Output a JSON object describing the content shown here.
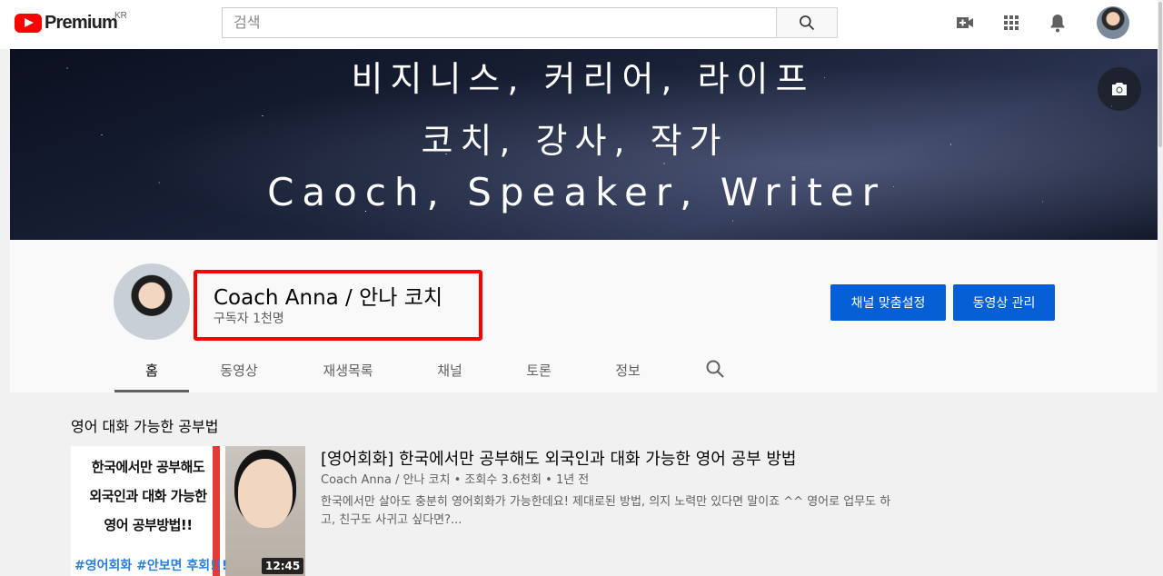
{
  "topbar": {
    "logo_text": "Premium",
    "country_code": "KR",
    "search_placeholder": "검색"
  },
  "banner": {
    "line1": "비지니스, 커리어, 라이프",
    "line2": "코치, 강사, 작가",
    "line3": "Caoch, Speaker, Writer"
  },
  "channel": {
    "name": "Coach Anna / 안나 코치",
    "subscribers": "구독자 1천명",
    "customize_label": "채널 맞춤설정",
    "manage_label": "동영상 관리",
    "accent_color": "#065fd4",
    "highlight_color": "#ff0000"
  },
  "tabs": [
    {
      "label": "홈",
      "active": true
    },
    {
      "label": "동영상"
    },
    {
      "label": "재생목록"
    },
    {
      "label": "채널"
    },
    {
      "label": "토론"
    },
    {
      "label": "정보"
    }
  ],
  "section": {
    "title": "영어 대화 가능한 공부법"
  },
  "video": {
    "thumb_line1": "한국에서만 공부해도",
    "thumb_line2": "외국인과 대화 가능한",
    "thumb_line3": "영어 공부방법!!",
    "thumb_tags": "#영어회화 #안보면 후회!!!",
    "duration": "12:45",
    "title": "[영어회화] 한국에서만 공부해도 외국인과 대화 가능한 영어 공부 방법",
    "meta": "Coach Anna / 안나 코치 • 조회수 3.6천회 • 1년 전",
    "description": "한국에서만 살아도 충분히 영어회화가 가능한데요! 제대로된 방법, 의지 노력만 있다면 말이죠 ^^ 영어로 업무도 하고, 친구도 사귀고 싶다면?..."
  },
  "icons": [
    "youtube-logo-icon",
    "search-icon",
    "create-video-icon",
    "apps-grid-icon",
    "notifications-bell-icon",
    "account-avatar",
    "camera-icon",
    "channel-search-icon"
  ]
}
